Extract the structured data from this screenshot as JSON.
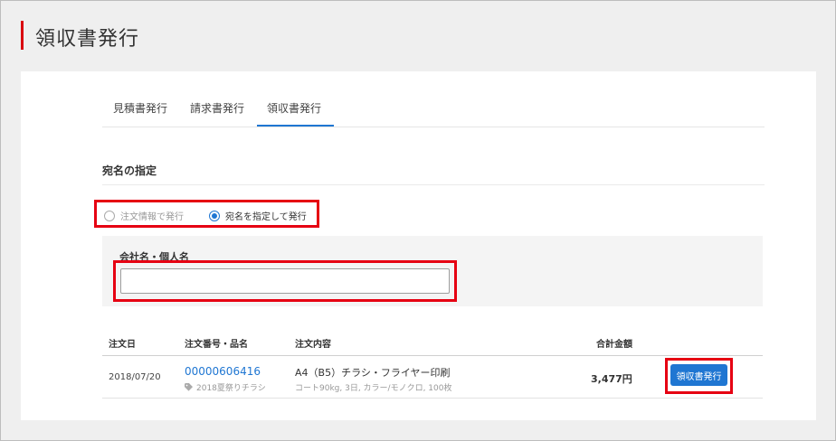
{
  "header": {
    "title": "領収書発行"
  },
  "tabs": [
    {
      "label": "見積書発行",
      "active": false
    },
    {
      "label": "請求書発行",
      "active": false
    },
    {
      "label": "領収書発行",
      "active": true
    }
  ],
  "section": {
    "title": "宛名の指定"
  },
  "radios": [
    {
      "label": "注文情報で発行",
      "checked": false
    },
    {
      "label": "宛名を指定して発行",
      "checked": true
    }
  ],
  "name_field": {
    "label": "会社名・個人名",
    "value": ""
  },
  "table": {
    "headers": [
      "注文日",
      "注文番号・品名",
      "注文内容",
      "合計金額"
    ],
    "rows": [
      {
        "date": "2018/07/20",
        "order_number": "00000606416",
        "tag": "2018夏祭りチラシ",
        "content": "A4（B5）チラシ・フライヤー印刷",
        "content_detail": "コート90kg, 3日, カラー/モノクロ, 100枚",
        "total": "3,477円",
        "action_label": "領収書発行"
      }
    ]
  },
  "colors": {
    "accent": "#1f76d2",
    "highlight": "#e60012",
    "title_bar": "#d9000f"
  },
  "icons": {
    "tag": "tag-icon"
  }
}
